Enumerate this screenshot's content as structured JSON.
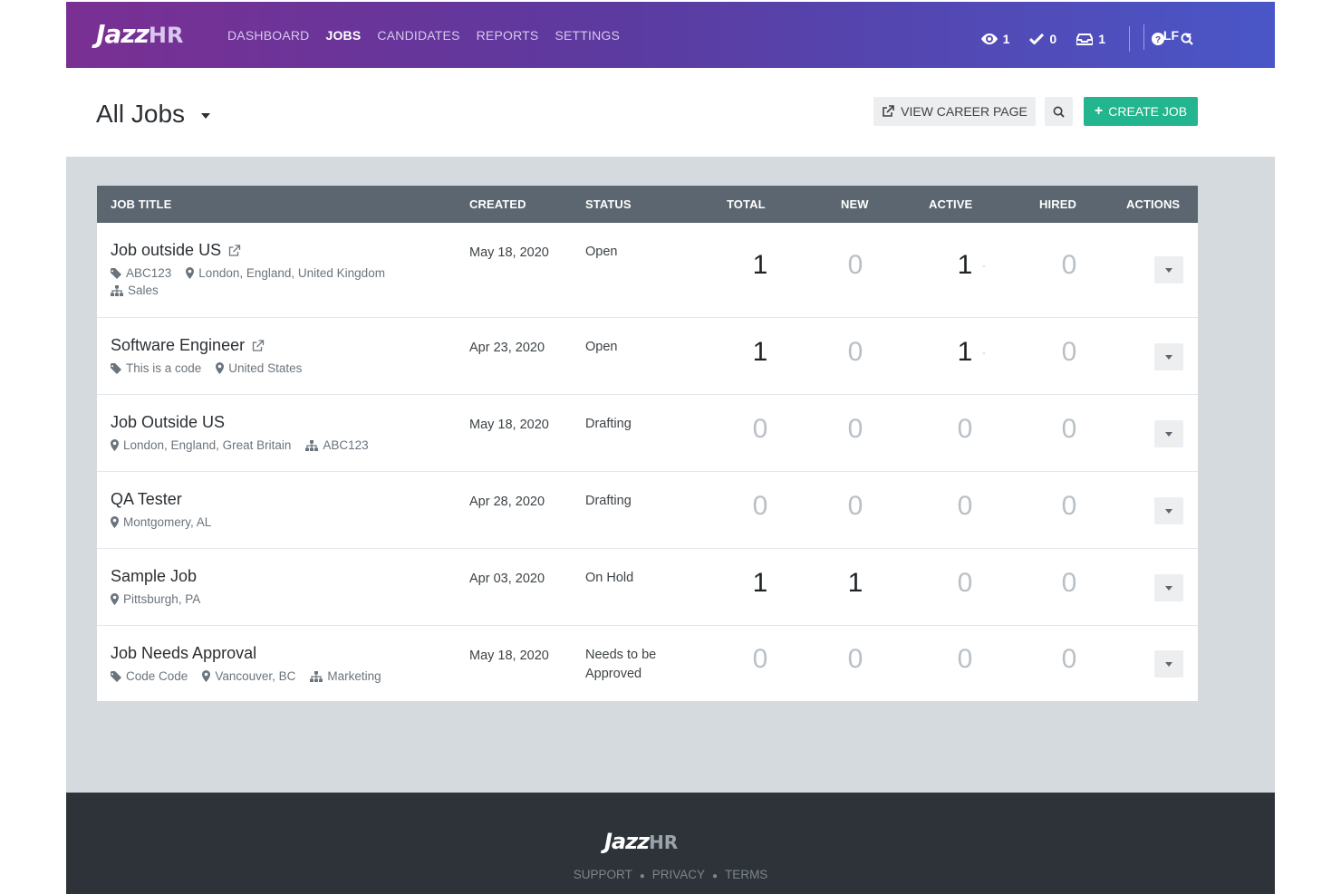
{
  "brand": {
    "logo_main": "Jazz",
    "logo_hr": "HR"
  },
  "nav": {
    "links": [
      "DASHBOARD",
      "JOBS",
      "CANDIDATES",
      "REPORTS",
      "SETTINGS"
    ],
    "active": "JOBS",
    "counters": {
      "views": "1",
      "tasks": "0",
      "inbox": "1"
    },
    "user": "LF"
  },
  "header": {
    "title": "All Jobs",
    "view_career_label": "VIEW CAREER PAGE",
    "create_job_label": "CREATE JOB"
  },
  "table": {
    "columns": {
      "title": "JOB TITLE",
      "created": "CREATED",
      "status": "STATUS",
      "total": "TOTAL",
      "new": "NEW",
      "active": "ACTIVE",
      "hired": "HIRED",
      "actions": "ACTIONS"
    },
    "rows": [
      {
        "title": "Job outside US",
        "external": true,
        "meta1": [
          {
            "icon": "tag",
            "text": "ABC123"
          },
          {
            "icon": "pin",
            "text": "London, England, United Kingdom"
          }
        ],
        "meta2": [
          {
            "icon": "org",
            "text": "Sales"
          }
        ],
        "created": "May 18, 2020",
        "status": "Open",
        "total": "1",
        "new": "0",
        "active": "1",
        "hired": "0"
      },
      {
        "title": "Software Engineer",
        "external": true,
        "meta1": [
          {
            "icon": "tag",
            "text": "This is a code"
          },
          {
            "icon": "pin",
            "text": "United States"
          }
        ],
        "meta2": [],
        "created": "Apr 23, 2020",
        "status": "Open",
        "total": "1",
        "new": "0",
        "active": "1",
        "hired": "0"
      },
      {
        "title": "Job Outside US",
        "external": false,
        "meta1": [
          {
            "icon": "pin",
            "text": "London, England, Great Britain"
          },
          {
            "icon": "org",
            "text": "ABC123"
          }
        ],
        "meta2": [],
        "created": "May 18, 2020",
        "status": "Drafting",
        "total": "0",
        "new": "0",
        "active": "0",
        "hired": "0"
      },
      {
        "title": "QA Tester",
        "external": false,
        "meta1": [
          {
            "icon": "pin",
            "text": "Montgomery, AL"
          }
        ],
        "meta2": [],
        "created": "Apr 28, 2020",
        "status": "Drafting",
        "total": "0",
        "new": "0",
        "active": "0",
        "hired": "0"
      },
      {
        "title": "Sample Job",
        "external": false,
        "meta1": [
          {
            "icon": "pin",
            "text": "Pittsburgh, PA"
          }
        ],
        "meta2": [],
        "created": "Apr 03, 2020",
        "status": "On Hold",
        "total": "1",
        "new": "1",
        "active": "0",
        "hired": "0"
      },
      {
        "title": "Job Needs Approval",
        "external": false,
        "meta1": [
          {
            "icon": "tag",
            "text": "Code Code"
          },
          {
            "icon": "pin",
            "text": "Vancouver, BC"
          },
          {
            "icon": "org",
            "text": "Marketing"
          }
        ],
        "meta2": [],
        "created": "May 18, 2020",
        "status": "Needs to be Approved",
        "total": "0",
        "new": "0",
        "active": "0",
        "hired": "0"
      }
    ]
  },
  "footer": {
    "logo_main": "Jazz",
    "logo_hr": "HR",
    "links": [
      "SUPPORT",
      "PRIVACY",
      "TERMS"
    ]
  },
  "colors": {
    "accent_green": "#23b68e",
    "header_purple": "#7a2f93",
    "header_blue": "#4a56c7",
    "table_head": "#5b6670"
  }
}
